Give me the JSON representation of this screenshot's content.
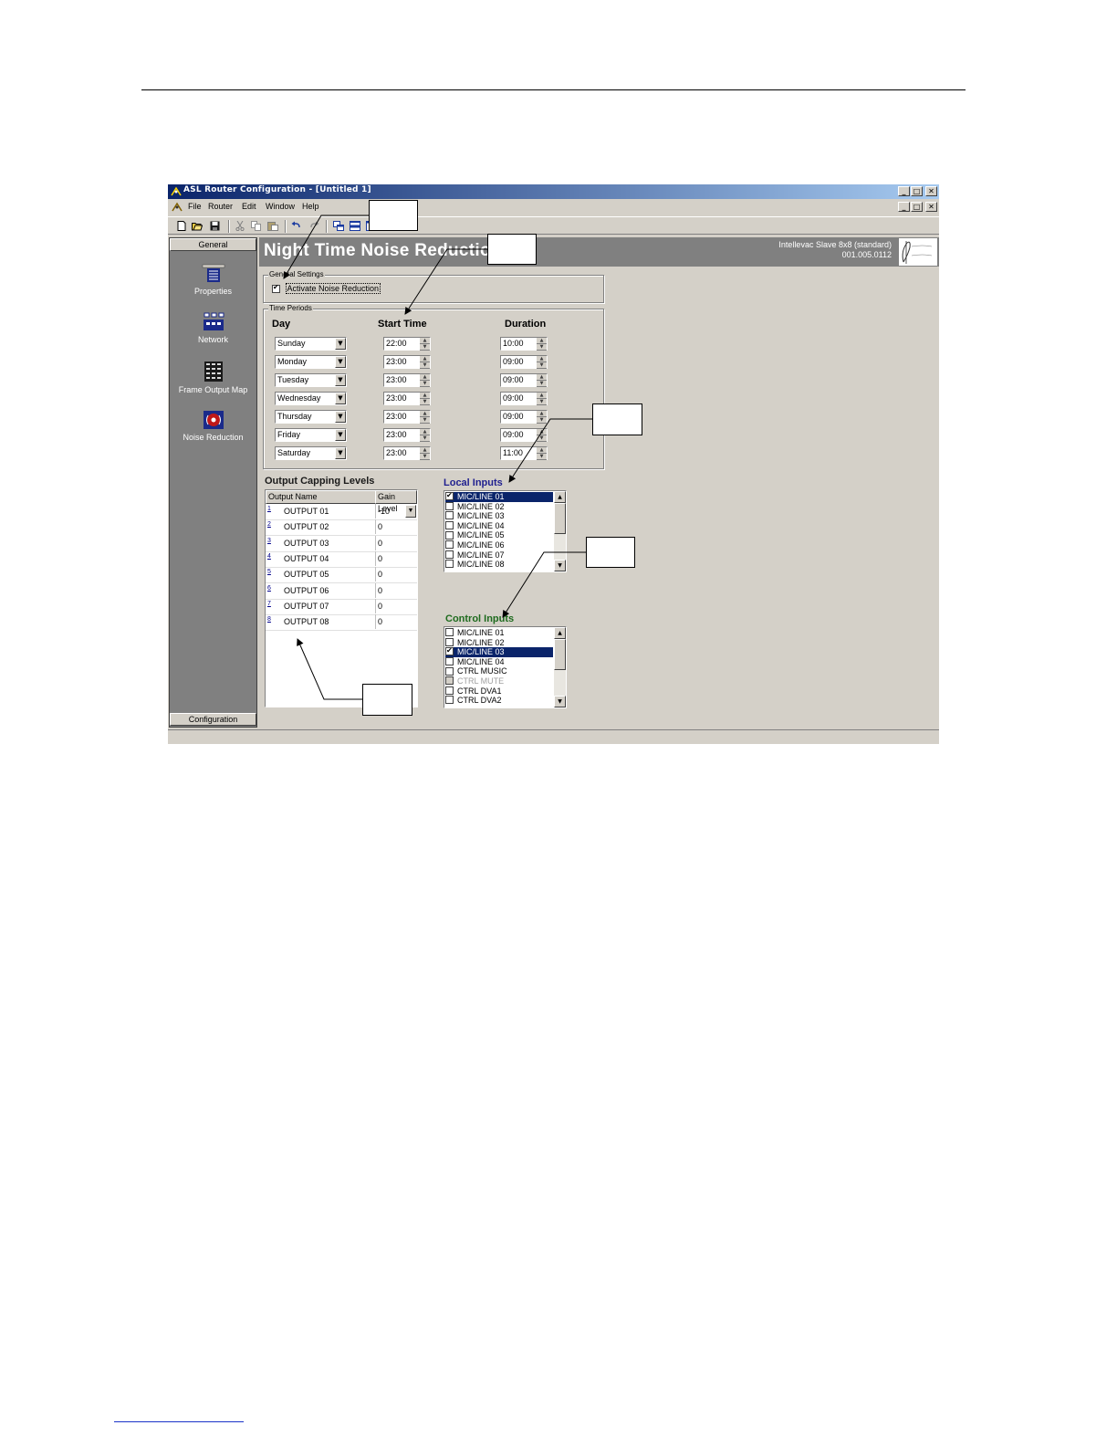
{
  "window": {
    "title": "ASL Router Configuration - [Untitled 1]",
    "caption_buttons": [
      "_",
      "□",
      "✕"
    ]
  },
  "menu": [
    "File",
    "Router",
    "Edit",
    "Window",
    "Help"
  ],
  "toolbar_icons": [
    "new-icon",
    "open-icon",
    "save-icon",
    "cut-icon",
    "copy-icon",
    "paste-icon",
    "undo-icon",
    "redo-icon",
    "cascade-icon",
    "tile-icon",
    "window-icon"
  ],
  "sidebar": {
    "header": "General",
    "footer": "Configuration",
    "items": [
      {
        "label": "Properties",
        "icon": "properties-icon"
      },
      {
        "label": "Network",
        "icon": "network-icon"
      },
      {
        "label": "Frame Output Map",
        "icon": "frame-output-map-icon"
      },
      {
        "label": "Noise Reduction",
        "icon": "noise-reduction-icon"
      }
    ]
  },
  "banner": {
    "title": "Night Time Noise Reduction",
    "device_line1": "Intellevac Slave 8x8 (standard)",
    "device_line2": "001.005.0112"
  },
  "general_settings": {
    "legend": "General Settings",
    "activate_label": "Activate Noise Reduction",
    "activate_checked": true
  },
  "time_periods": {
    "legend": "Time Periods",
    "headers": {
      "day": "Day",
      "start": "Start Time",
      "duration": "Duration"
    },
    "rows": [
      {
        "day": "Sunday",
        "start": "22:00",
        "duration": "10:00"
      },
      {
        "day": "Monday",
        "start": "23:00",
        "duration": "09:00"
      },
      {
        "day": "Tuesday",
        "start": "23:00",
        "duration": "09:00"
      },
      {
        "day": "Wednesday",
        "start": "23:00",
        "duration": "09:00"
      },
      {
        "day": "Thursday",
        "start": "23:00",
        "duration": "09:00"
      },
      {
        "day": "Friday",
        "start": "23:00",
        "duration": "09:00"
      },
      {
        "day": "Saturday",
        "start": "23:00",
        "duration": "11:00"
      }
    ]
  },
  "output_capping": {
    "title": "Output Capping Levels",
    "col_name": "Output Name",
    "col_gain": "Gain Level",
    "rows": [
      {
        "num": "1",
        "name": "OUTPUT 01",
        "gain": "-10"
      },
      {
        "num": "2",
        "name": "OUTPUT 02",
        "gain": "0"
      },
      {
        "num": "3",
        "name": "OUTPUT 03",
        "gain": "0"
      },
      {
        "num": "4",
        "name": "OUTPUT 04",
        "gain": "0"
      },
      {
        "num": "5",
        "name": "OUTPUT 05",
        "gain": "0"
      },
      {
        "num": "6",
        "name": "OUTPUT 06",
        "gain": "0"
      },
      {
        "num": "7",
        "name": "OUTPUT 07",
        "gain": "0"
      },
      {
        "num": "8",
        "name": "OUTPUT 08",
        "gain": "0"
      }
    ]
  },
  "local_inputs": {
    "title": "Local Inputs",
    "color": "#1f1f8f",
    "items": [
      {
        "label": "MIC/LINE 01",
        "checked": true,
        "selected": true
      },
      {
        "label": "MIC/LINE 02",
        "checked": false
      },
      {
        "label": "MIC/LINE 03",
        "checked": false
      },
      {
        "label": "MIC/LINE 04",
        "checked": false
      },
      {
        "label": "MIC/LINE 05",
        "checked": false
      },
      {
        "label": "MIC/LINE 06",
        "checked": false
      },
      {
        "label": "MIC/LINE 07",
        "checked": false
      },
      {
        "label": "MIC/LINE 08",
        "checked": false
      }
    ]
  },
  "control_inputs": {
    "title": "Control Inputs",
    "color": "#1e6b1e",
    "items": [
      {
        "label": "MIC/LINE 01",
        "checked": false
      },
      {
        "label": "MIC/LINE 02",
        "checked": false
      },
      {
        "label": "MIC/LINE 03",
        "checked": true,
        "selected": true
      },
      {
        "label": "MIC/LINE 04",
        "checked": false
      },
      {
        "label": "CTRL MUSIC",
        "checked": false
      },
      {
        "label": "CTRL MUTE",
        "checked": false,
        "disabled": true
      },
      {
        "label": "CTRL DVA1",
        "checked": false
      },
      {
        "label": "CTRL DVA2",
        "checked": false
      }
    ]
  },
  "colors": {
    "titlebar_start": "#0a246a",
    "titlebar_end": "#a6caf0",
    "face": "#d4d0c8",
    "sidebar": "#808080",
    "banner": "#808080"
  }
}
